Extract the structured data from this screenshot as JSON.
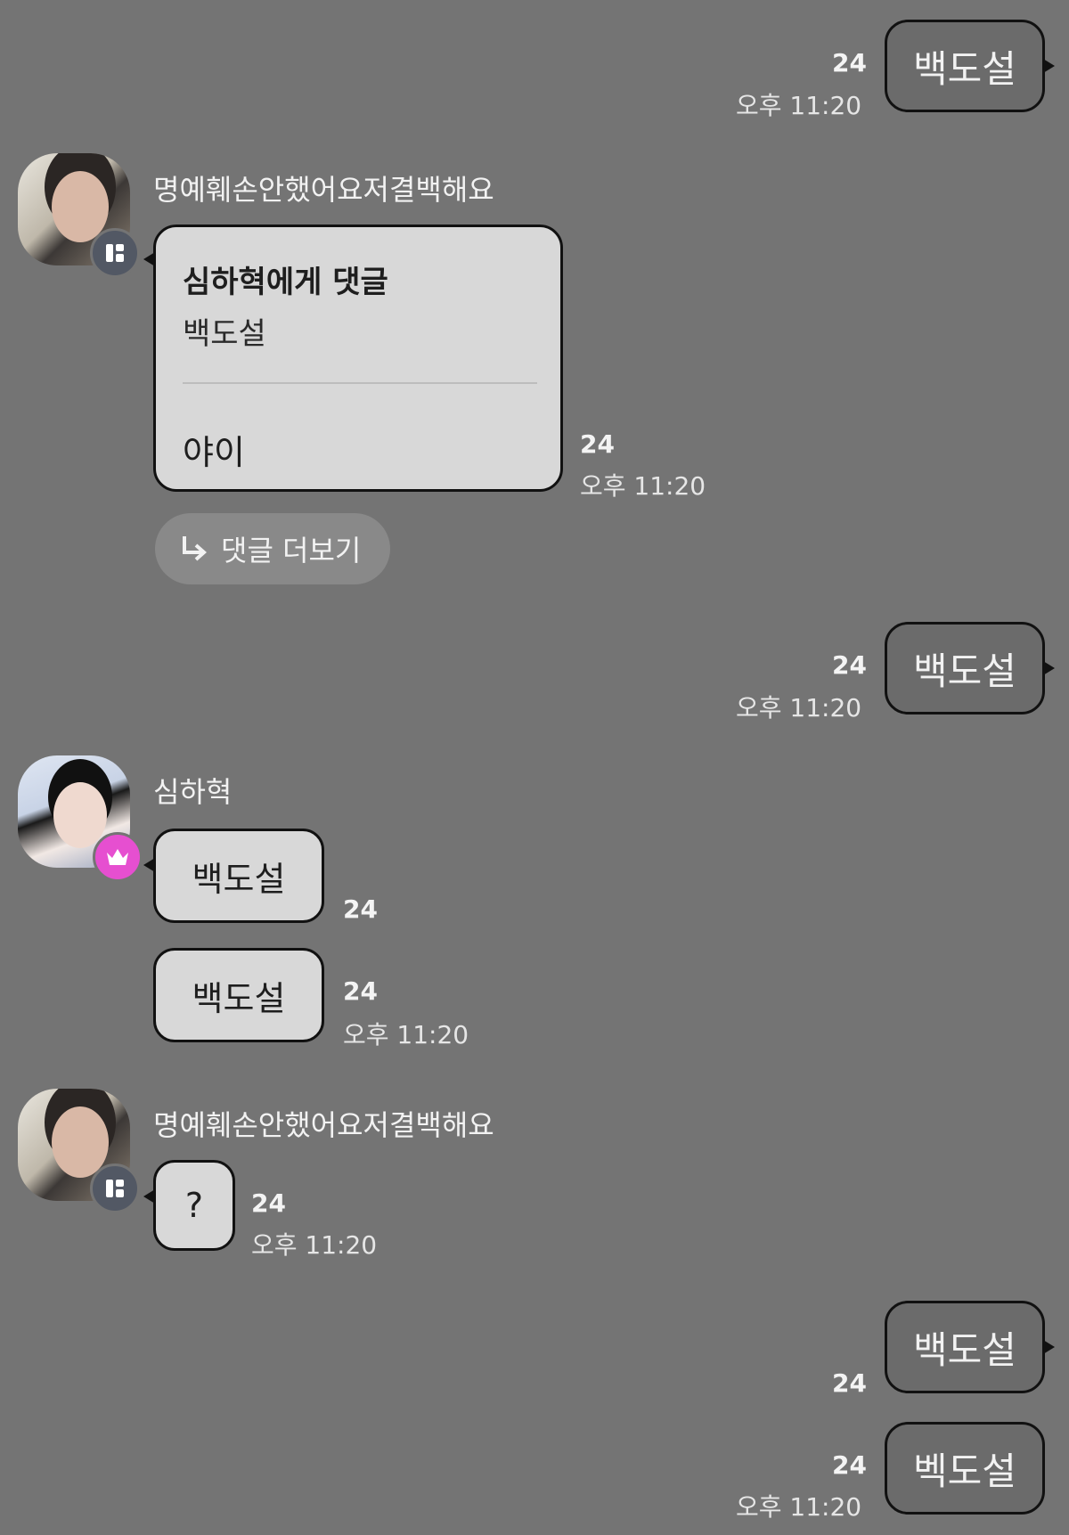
{
  "messages": {
    "out1": {
      "text": "백도설",
      "count": "24",
      "time": "오후 11:20"
    },
    "in1": {
      "sender": "명예훼손안했어요저결백해요",
      "reply_title": "심하혁에게 댓글",
      "reply_quote": "백도설",
      "text": "야이",
      "count": "24",
      "time": "오후 11:20",
      "more_replies_label": "댓글 더보기"
    },
    "out2": {
      "text": "백도설",
      "count": "24",
      "time": "오후 11:20"
    },
    "in2": {
      "sender": "심하혁",
      "msg1": {
        "text": "백도설",
        "count": "24"
      },
      "msg2": {
        "text": "백도설",
        "count": "24",
        "time": "오후 11:20"
      }
    },
    "in3": {
      "sender": "명예훼손안했어요저결백해요",
      "text": "?",
      "count": "24",
      "time": "오후 11:20"
    },
    "out3": {
      "msg1": {
        "text": "백도설",
        "count": "24"
      },
      "msg2": {
        "text": "벡도설",
        "count": "24",
        "time": "오후 11:20"
      }
    }
  },
  "icons": {
    "badge_gray": "profile-card-icon",
    "badge_pink": "crown-icon",
    "reply_arrow": "reply-arrow-icon"
  },
  "colors": {
    "background": "#747474",
    "outgoing_bubble": "#6b6b6b",
    "incoming_bubble": "#d8d8d8",
    "crown_badge": "#e64fd0",
    "card_badge": "#525864"
  }
}
